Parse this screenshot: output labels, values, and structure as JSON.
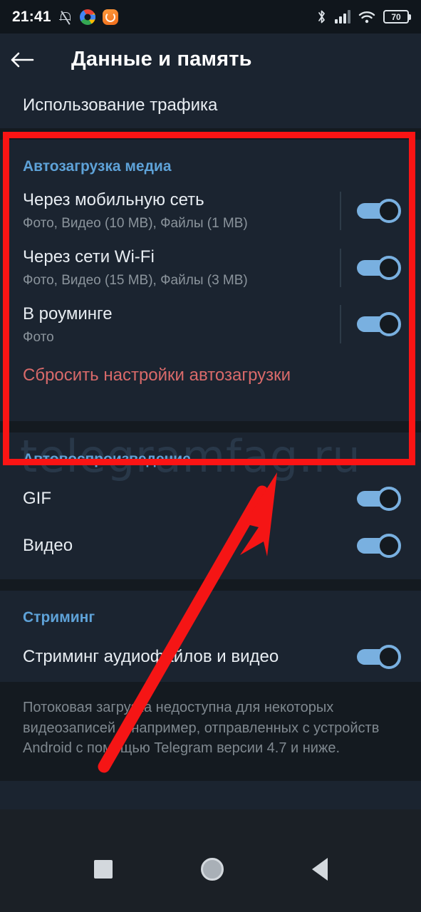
{
  "statusbar": {
    "time": "21:41",
    "icons_left": [
      "bell-mute-icon",
      "google-icon",
      "orange-app-icon"
    ],
    "icons_right": [
      "bluetooth-icon",
      "cellular-signal-icon",
      "wifi-icon",
      "battery-icon"
    ],
    "battery_level": "70"
  },
  "appbar": {
    "back_icon": "back-arrow-icon",
    "title": "Данные и память"
  },
  "traffic": {
    "label": "Использование трафика"
  },
  "autodownload": {
    "header": "Автозагрузка медиа",
    "rows": [
      {
        "title": "Через мобильную сеть",
        "subtitle": "Фото, Видео (10 MB), Файлы (1 MB)",
        "toggle": "on"
      },
      {
        "title": "Через сети Wi-Fi",
        "subtitle": "Фото, Видео (15 MB), Файлы (3 MB)",
        "toggle": "on"
      },
      {
        "title": "В роуминге",
        "subtitle": "Фото",
        "toggle": "on"
      }
    ],
    "reset_label": "Сбросить настройки автозагрузки"
  },
  "autoplay": {
    "header": "Автовоспроизведение",
    "rows": [
      {
        "title": "GIF",
        "toggle": "on"
      },
      {
        "title": "Видео",
        "toggle": "on"
      }
    ]
  },
  "streaming": {
    "header": "Стриминг",
    "rows": [
      {
        "title": "Стриминг аудиофайлов и видео",
        "toggle": "on"
      }
    ],
    "note": "Потоковая загрузка недоступна для некоторых видеозаписей – например, отправленных с устройств Android с помощью Telegram версии 4.7 и ниже."
  },
  "navbar": {
    "recents": "recents-square-icon",
    "home": "home-circle-icon",
    "back": "back-triangle-icon"
  },
  "watermark": {
    "text": "telegramfag.ru"
  },
  "annotations": {
    "highlight_color": "#fb1414",
    "arrow_color": "#f51515"
  },
  "colors": {
    "accent_blue": "#5ea2d8",
    "toggle_on": "#79b0e0",
    "danger": "#d96a6a",
    "panel_bg": "#1b2430",
    "page_bg": "#141a20"
  }
}
